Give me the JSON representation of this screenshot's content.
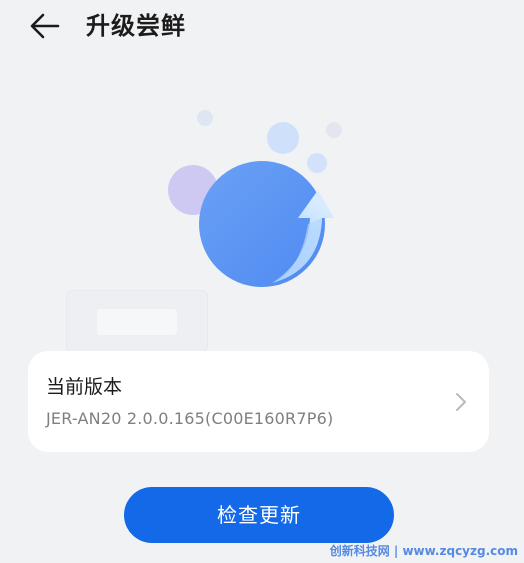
{
  "header": {
    "title": "升级尝鲜",
    "back_icon": "arrow-left-icon"
  },
  "illustration": {
    "icon": "upgrade-circle-arrow-icon",
    "main_color": "#5e97f4",
    "accent_color": "#c9c6f2"
  },
  "version_card": {
    "title": "当前版本",
    "value": "JER-AN20 2.0.0.165(C00E160R7P6)",
    "chevron_icon": "chevron-right-icon"
  },
  "check_update": {
    "label": "检查更新",
    "color": "#1469e8"
  },
  "watermark": {
    "text": "创新科技网 | www.zqcyzg.com"
  }
}
